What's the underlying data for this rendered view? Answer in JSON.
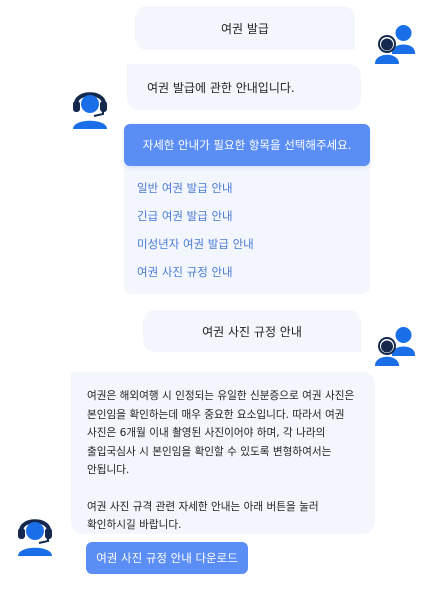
{
  "colors": {
    "accent": "#5b8ef5",
    "link": "#4a7ad6",
    "bubble_bg": "#f3f7fd",
    "icon_blue": "#1a6fe8",
    "icon_navy": "#14294d"
  },
  "messages": {
    "user_request_1": "여권 발급",
    "bot_intro": "여권 발급에 관한 안내입니다.",
    "menu": {
      "header": "자세한 안내가 필요한 항목을 선택해주세요.",
      "items": [
        "일반 여권 발급 안내",
        "긴급 여권 발급 안내",
        "미성년자 여권 발급 안내",
        "여권 사진 규정 안내"
      ]
    },
    "user_request_2": "여권 사진 규정 안내",
    "bot_answer": {
      "paragraph1": "여권은 해외여행 시 인정되는 유일한 신분증으로 여권 사진은 본인임을 확인하는데 매우 중요한 요소입니다. 따라서 여권 사진은 6개월 이내 촬영된 사진이어야 하며, 각 나라의 출입국심사 시 본인임을 확인할 수 있도록 변형하여서는 안됩니다.",
      "paragraph2": "여권 사진 규격 관련 자세한 안내는 아래 버튼을 눌러 확인하시길 바랍니다."
    },
    "download_button": "여권 사진 규정 안내 다운로드"
  },
  "icons": {
    "user_avatar": "users-icon",
    "bot_avatar": "headset-agent-icon"
  }
}
